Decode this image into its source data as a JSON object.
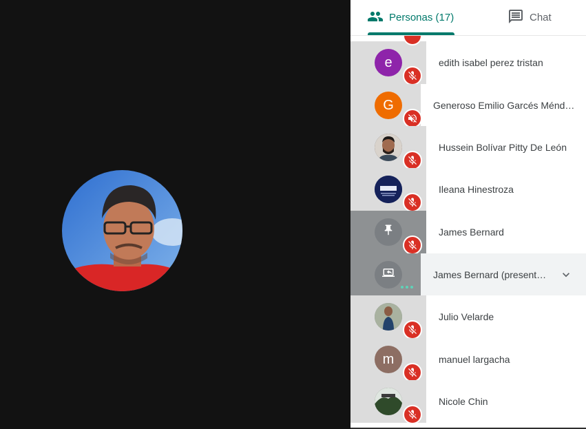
{
  "tabs": {
    "people_label": "Personas (17)",
    "chat_label": "Chat"
  },
  "participants": [
    {
      "name": "edith isabel perez tristan",
      "initial": "e",
      "avatar_color": "#8e24aa",
      "status": "muted"
    },
    {
      "name": "Generoso Emilio Garcés Ménd…",
      "initial": "G",
      "avatar_color": "#ef6c00",
      "status": "audio-muted"
    },
    {
      "name": "Hussein Bolívar Pitty De León",
      "initial": "",
      "avatar_color": "#3b2f2a",
      "status": "muted"
    },
    {
      "name": "Ileana Hinestroza",
      "initial": "",
      "avatar_color": "#1a2b6d",
      "status": "muted"
    },
    {
      "name": "James Bernard",
      "initial": "",
      "avatar_color": "#8e9193",
      "status": "muted"
    },
    {
      "name": "James Bernard (present…",
      "initial": "",
      "avatar_color": "#8e9193",
      "status": "speaking"
    },
    {
      "name": "Julio Velarde",
      "initial": "",
      "avatar_color": "#6f7b86",
      "status": "muted"
    },
    {
      "name": "manuel largacha",
      "initial": "m",
      "avatar_color": "#8d6e63",
      "status": "muted"
    },
    {
      "name": "Nicole Chin",
      "initial": "",
      "avatar_color": "#2e3b2a",
      "status": "muted"
    }
  ],
  "colors": {
    "accent": "#00796b",
    "muted_red": "#d93025",
    "stage_bg": "#121212"
  }
}
